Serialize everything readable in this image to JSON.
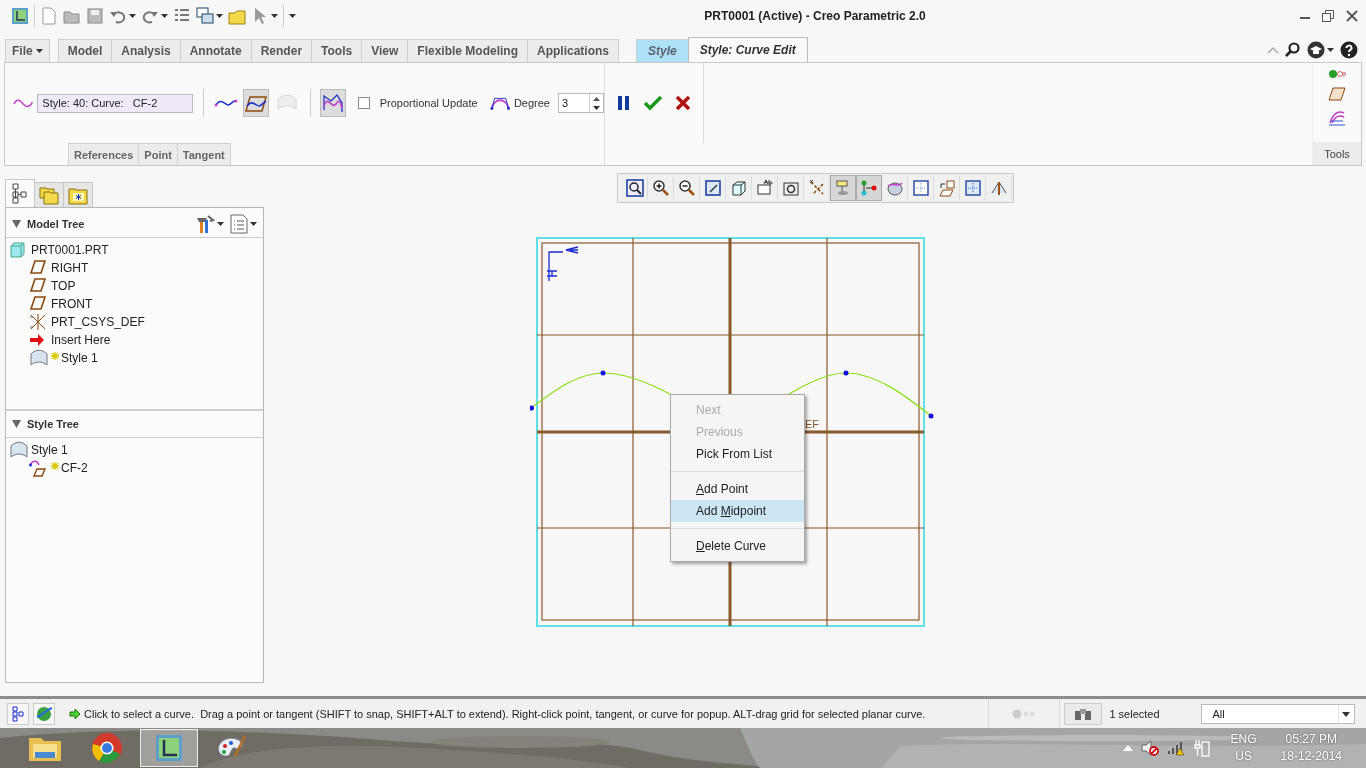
{
  "window": {
    "title": "PRT0001 (Active) - Creo Parametric 2.0"
  },
  "ribbon_tabs": [
    {
      "label": "File",
      "kind": "file",
      "selected": false
    },
    {
      "label": "Model",
      "kind": "tab",
      "selected": false
    },
    {
      "label": "Analysis",
      "kind": "tab",
      "selected": false
    },
    {
      "label": "Annotate",
      "kind": "tab",
      "selected": false
    },
    {
      "label": "Render",
      "kind": "tab",
      "selected": false
    },
    {
      "label": "Tools",
      "kind": "tab",
      "selected": false
    },
    {
      "label": "View",
      "kind": "tab",
      "selected": false
    },
    {
      "label": "Flexible Modeling",
      "kind": "tab",
      "selected": false
    },
    {
      "label": "Applications",
      "kind": "tab",
      "selected": false
    },
    {
      "label": "Style",
      "kind": "context",
      "selected": false
    },
    {
      "label": "Style: Curve Edit",
      "kind": "context",
      "selected": true
    }
  ],
  "dashboard": {
    "curve_field": {
      "value": "Style: 40: Curve:   CF-2"
    },
    "curve_type_buttons": [
      {
        "pressed": false,
        "disabled": false
      },
      {
        "pressed": true,
        "disabled": false
      },
      {
        "pressed": false,
        "disabled": true
      }
    ],
    "control_polygon": {
      "pressed": true
    },
    "proportional_update": {
      "label": "Proportional Update",
      "checked": false
    },
    "degree": {
      "label": "Degree",
      "value": "3"
    },
    "slide_tabs": [
      {
        "label": "References"
      },
      {
        "label": "Point"
      },
      {
        "label": "Tangent"
      }
    ],
    "tools_group": {
      "label": "Tools"
    }
  },
  "navigator_tabs": [
    {
      "selected": true
    },
    {
      "selected": false
    },
    {
      "selected": false
    }
  ],
  "model_tree": {
    "title": "Model Tree",
    "expanded": true,
    "items": [
      {
        "label": "PRT0001.PRT",
        "kind": "part",
        "new": false,
        "children": [
          {
            "label": "RIGHT",
            "kind": "plane",
            "new": false
          },
          {
            "label": "TOP",
            "kind": "plane",
            "new": false
          },
          {
            "label": "FRONT",
            "kind": "plane",
            "new": false
          },
          {
            "label": "PRT_CSYS_DEF",
            "kind": "csys",
            "new": false
          },
          {
            "label": "Insert Here",
            "kind": "insert",
            "new": false
          },
          {
            "label": "Style 1",
            "kind": "style",
            "new": true
          }
        ]
      }
    ]
  },
  "style_tree": {
    "title": "Style Tree",
    "expanded": true,
    "items": [
      {
        "label": "Style 1",
        "kind": "style",
        "new": false,
        "children": [
          {
            "label": "CF-2",
            "kind": "curve",
            "new": true
          }
        ]
      }
    ]
  },
  "graphics_toolbar": [
    {
      "pressed": false
    },
    {
      "pressed": false
    },
    {
      "pressed": false
    },
    {
      "pressed": false
    },
    {
      "pressed": false
    },
    {
      "pressed": false
    },
    {
      "pressed": false
    },
    {
      "pressed": false
    },
    {
      "pressed": true
    },
    {
      "pressed": true
    },
    {
      "pressed": false
    },
    {
      "pressed": false
    },
    {
      "pressed": false
    },
    {
      "pressed": false
    },
    {
      "pressed": false
    }
  ],
  "canvas": {
    "datum_label": "EF"
  },
  "context_menu": [
    {
      "kind": "item",
      "disabled": true,
      "selected": false,
      "label": [
        {
          "text": "Next",
          "underline": false
        }
      ]
    },
    {
      "kind": "item",
      "disabled": true,
      "selected": false,
      "label": [
        {
          "text": "Previous",
          "underline": false
        }
      ]
    },
    {
      "kind": "item",
      "disabled": false,
      "selected": false,
      "label": [
        {
          "text": "Pick From List",
          "underline": false
        }
      ]
    },
    {
      "kind": "separator"
    },
    {
      "kind": "item",
      "disabled": false,
      "selected": false,
      "label": [
        {
          "text": "A",
          "underline": true
        },
        {
          "text": "dd Point",
          "underline": false
        }
      ]
    },
    {
      "kind": "item",
      "disabled": false,
      "selected": true,
      "label": [
        {
          "text": "Add ",
          "underline": false
        },
        {
          "text": "M",
          "underline": true
        },
        {
          "text": "idpoint",
          "underline": false
        }
      ]
    },
    {
      "kind": "separator"
    },
    {
      "kind": "item",
      "disabled": false,
      "selected": false,
      "label": [
        {
          "text": "D",
          "underline": true
        },
        {
          "text": "elete Curve",
          "underline": false
        }
      ]
    }
  ],
  "status_bar": {
    "message": "Click to select a curve.  Drag a point or tangent (SHIFT to snap, SHIFT+ALT to extend). Right-click point, tangent, or curve for popup. ALT-drag grid for selected planar curve.",
    "selection_count": "1 selected",
    "filter": "All"
  },
  "taskbar": {
    "apps": [
      {
        "selected": false
      },
      {
        "selected": false
      },
      {
        "selected": true
      },
      {
        "selected": false
      }
    ],
    "tray": {
      "language": "ENG",
      "region": "US",
      "time": "05:27 PM",
      "date": "18-12-2014"
    }
  }
}
